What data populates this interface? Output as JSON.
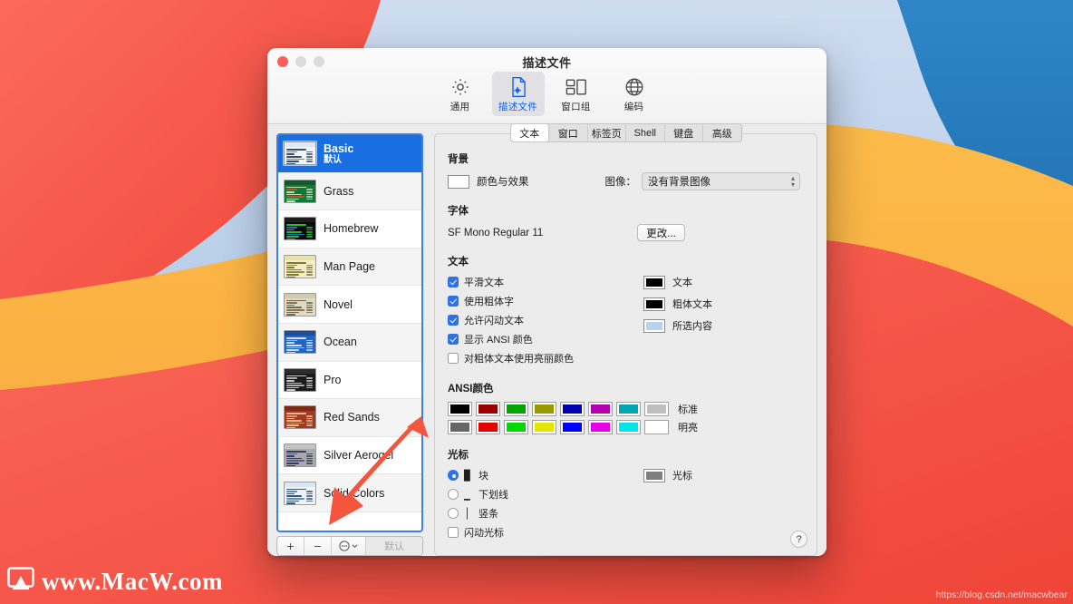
{
  "window": {
    "title": "描述文件",
    "traffic_lights": [
      "close",
      "minimize",
      "maximize"
    ]
  },
  "toolbar": {
    "items": [
      {
        "label": "通用",
        "icon": "gear-icon",
        "active": false
      },
      {
        "label": "描述文件",
        "icon": "document-gear-icon",
        "active": true
      },
      {
        "label": "窗口组",
        "icon": "window-group-icon",
        "active": false
      },
      {
        "label": "编码",
        "icon": "globe-icon",
        "active": false
      }
    ]
  },
  "sidebar": {
    "profiles": [
      {
        "name": "Basic",
        "subtitle": "默认",
        "selected": true,
        "bg": "#f2f6fb",
        "fg": "#17314f",
        "accent": "#2f6fc0",
        "titlebar": "#dfe9f5"
      },
      {
        "name": "Grass",
        "subtitle": "",
        "selected": false,
        "bg": "#13773a",
        "fg": "#d8f0c8",
        "accent": "#d6502a",
        "titlebar": "#0e5c2c"
      },
      {
        "name": "Homebrew",
        "subtitle": "",
        "selected": false,
        "bg": "#0a0a0a",
        "fg": "#2bd84a",
        "accent": "#2f7fe0",
        "titlebar": "#1c1c1c"
      },
      {
        "name": "Man Page",
        "subtitle": "",
        "selected": false,
        "bg": "#f3eec4",
        "fg": "#6b6024",
        "accent": "#8d7b21",
        "titlebar": "#e6dfae"
      },
      {
        "name": "Novel",
        "subtitle": "",
        "selected": false,
        "bg": "#dfdbc3",
        "fg": "#5a5344",
        "accent": "#8a5a3a",
        "titlebar": "#d0cab0"
      },
      {
        "name": "Ocean",
        "subtitle": "",
        "selected": false,
        "bg": "#2265c4",
        "fg": "#eaf2ff",
        "accent": "#9fd0ff",
        "titlebar": "#1b4f9c"
      },
      {
        "name": "Pro",
        "subtitle": "",
        "selected": false,
        "bg": "#1a1a1a",
        "fg": "#e6e6e6",
        "accent": "#c8c8c8",
        "titlebar": "#2d2d2d"
      },
      {
        "name": "Red Sands",
        "subtitle": "",
        "selected": false,
        "bg": "#a5391e",
        "fg": "#f2cfae",
        "accent": "#f0a860",
        "titlebar": "#7e2a14"
      },
      {
        "name": "Silver Aerogel",
        "subtitle": "",
        "selected": false,
        "bg": "#a8a8ae",
        "fg": "#2a2a42",
        "accent": "#4a4a8a",
        "titlebar": "#c4c4c8"
      },
      {
        "name": "Solid Colors",
        "subtitle": "",
        "selected": false,
        "bg": "#eef3f9",
        "fg": "#1e3a5c",
        "accent": "#3a7ac0",
        "titlebar": "#dce7f3"
      }
    ],
    "toolbar_buttons": {
      "add": "+",
      "remove": "−",
      "actions": "⋯",
      "default_label": "默认"
    }
  },
  "detail": {
    "tabs": [
      {
        "label": "文本",
        "active": true
      },
      {
        "label": "窗口",
        "active": false
      },
      {
        "label": "标签页",
        "active": false
      },
      {
        "label": "Shell",
        "active": false
      },
      {
        "label": "键盘",
        "active": false
      },
      {
        "label": "高级",
        "active": false
      }
    ],
    "background": {
      "section_title": "背景",
      "color_effects_label": "颜色与效果",
      "color_well": "#ffffff",
      "image_label": "图像：",
      "image_value": "没有背景图像"
    },
    "font": {
      "section_title": "字体",
      "value": "SF Mono Regular 11",
      "change_button": "更改..."
    },
    "text": {
      "section_title": "文本",
      "checkboxes": [
        {
          "label": "平滑文本",
          "checked": true
        },
        {
          "label": "使用粗体字",
          "checked": true
        },
        {
          "label": "允许闪动文本",
          "checked": true
        },
        {
          "label": "显示 ANSI 颜色",
          "checked": true
        },
        {
          "label": "对粗体文本使用亮丽颜色",
          "checked": false
        }
      ],
      "color_wells": [
        {
          "label": "文本",
          "color": "#000000"
        },
        {
          "label": "粗体文本",
          "color": "#000000"
        },
        {
          "label": "所选内容",
          "color": "#b5d3f0"
        }
      ]
    },
    "ansi": {
      "section_title": "ANSI颜色",
      "rows": [
        {
          "label": "标准",
          "colors": [
            "#000000",
            "#990000",
            "#00a600",
            "#999900",
            "#0000b2",
            "#b200b2",
            "#00a6b2",
            "#bfbfbf"
          ]
        },
        {
          "label": "明亮",
          "colors": [
            "#666666",
            "#e50000",
            "#00d900",
            "#e5e500",
            "#0000ff",
            "#e500e5",
            "#00e5e5",
            "#ffffff"
          ]
        }
      ]
    },
    "cursor": {
      "section_title": "光标",
      "options": [
        {
          "label": "块",
          "glyph": "█",
          "selected": true
        },
        {
          "label": "下划线",
          "glyph": "▁",
          "selected": false
        },
        {
          "label": "竖条",
          "glyph": "│",
          "selected": false
        }
      ],
      "blink_label": "闪动光标",
      "blink_checked": false,
      "color_well": {
        "label": "光标",
        "color": "#7f7f7f"
      }
    },
    "help_button": "?"
  },
  "watermarks": {
    "left_text": "www.MacW.com",
    "right_text": "https://blog.csdn.net/macwbear"
  },
  "annotation": {
    "arrow_color": "#f4553d",
    "points_to": "add-profile-button"
  },
  "theme": {
    "accent": "#1a6fe0",
    "window_bg": "#ececec",
    "wallpaper_red": "#f2564a",
    "wallpaper_blue": "#2a7fc0",
    "wallpaper_orange": "#fbb040"
  }
}
